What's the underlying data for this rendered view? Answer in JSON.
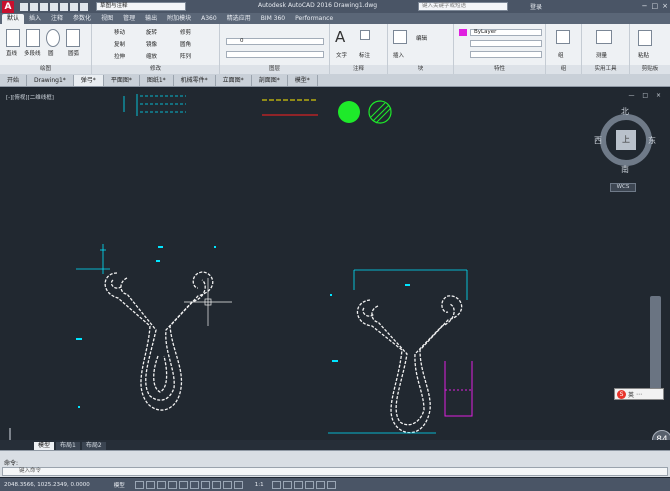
{
  "titlebar": {
    "logo": "A",
    "workspace": "草图与注释",
    "app_title": "Autodesk AutoCAD 2016    Drawing1.dwg",
    "search_placeholder": "键入关键字或短语",
    "user": "登录"
  },
  "tabs": [
    "默认",
    "插入",
    "注释",
    "参数化",
    "视图",
    "管理",
    "输出",
    "附加模块",
    "A360",
    "精选应用",
    "BIM 360",
    "Performance"
  ],
  "ribbon": {
    "groups": [
      {
        "label": "绘图"
      },
      {
        "label": "修改"
      },
      {
        "label": "图层"
      },
      {
        "label": "注释"
      },
      {
        "label": "块"
      },
      {
        "label": "特性"
      },
      {
        "label": "组"
      },
      {
        "label": "实用工具"
      },
      {
        "label": "剪贴板"
      }
    ],
    "draw_tools": [
      "直线",
      "多段线",
      "圆",
      "圆弧"
    ],
    "modify_tools": [
      "移动",
      "旋转",
      "修剪",
      "复制",
      "镜像",
      "圆角",
      "拉伸",
      "缩放",
      "阵列"
    ],
    "annotation_tools": [
      "文字",
      "标注"
    ],
    "block_tools": [
      "插入",
      "编辑"
    ],
    "property_value": "ByLayer",
    "layer_value": "0",
    "group_label": "组",
    "measure_label": "测量",
    "paste_label": "粘贴"
  },
  "file_tabs": [
    "开始",
    "Drawing1*",
    "弹弓*",
    "平面图*",
    "图纸1*",
    "机械零件*",
    "立面图*",
    "剖面图*",
    "模型*"
  ],
  "canvas": {
    "view_label": "[-][俯视][二维线框]",
    "compass": {
      "north": "北",
      "south": "南",
      "east": "东",
      "west": "西",
      "center": "上"
    },
    "wcs": "WCS"
  },
  "layout_tabs": [
    "模型",
    "布局1",
    "布局2"
  ],
  "command": {
    "history": "命令:",
    "placeholder": "键入命令"
  },
  "statusbar": {
    "coords": "2048.3566, 1025.2349, 0.0000",
    "mode": "模型",
    "scale": "1:1"
  },
  "badge": "84",
  "colors": {
    "canvas": "#212830",
    "cyan": "#00e5ff",
    "green": "#1eea2a",
    "yellow": "#ffee00",
    "red": "#ff2020",
    "magenta": "#e020e0",
    "white": "#f2f2f2"
  }
}
